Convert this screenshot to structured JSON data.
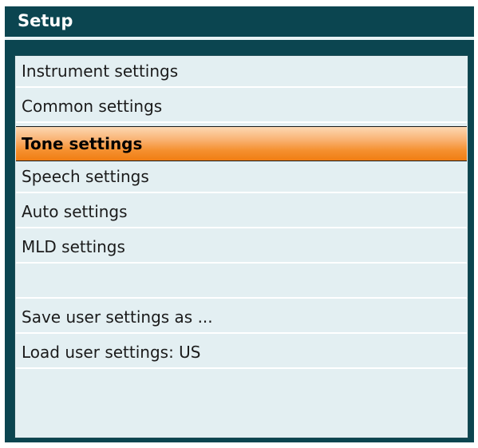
{
  "title": "Setup",
  "menu": {
    "items": [
      {
        "label": "Instrument settings"
      },
      {
        "label": "Common settings"
      },
      {
        "label": "Tone settings"
      },
      {
        "label": "Speech settings"
      },
      {
        "label": "Auto settings"
      },
      {
        "label": "MLD settings"
      },
      {
        "label": ""
      },
      {
        "label": "Save user settings as ..."
      },
      {
        "label": "Load user settings: US"
      }
    ],
    "selected_item": "Tone settings"
  },
  "colors": {
    "window_background": "#0b4550",
    "panel_background": "#e3eff2",
    "selection_gradient_top": "#fcd8b3",
    "selection_gradient_bottom": "#f07d12"
  }
}
